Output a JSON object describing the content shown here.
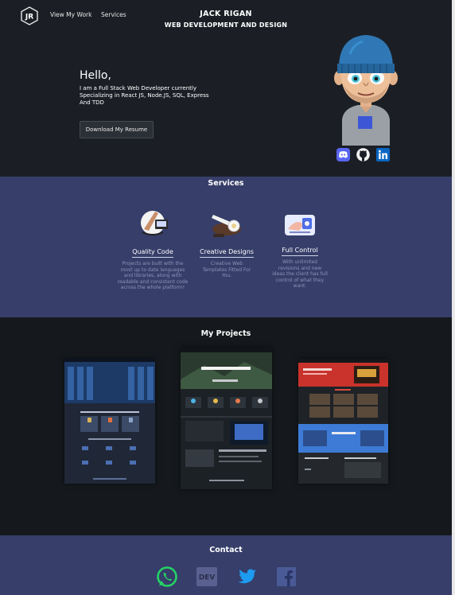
{
  "header": {
    "logo_text": "JR",
    "nav": {
      "work": "View My Work",
      "services": "Services"
    },
    "name": "JACK RIGAN",
    "subtitle": "WEB DEVELOPMENT AND DESIGN"
  },
  "hero": {
    "greeting": "Hello,",
    "intro": "I am a Full Stack Web Developer currently Specializing in React JS, Node.JS, SQL, Express And TDD",
    "resume_button": "Download My Resume",
    "social_icons": [
      "discord-icon",
      "github-icon",
      "linkedin-icon"
    ]
  },
  "services": {
    "title": "Services",
    "items": [
      {
        "title": "Quality Code",
        "desc": "Projects are built with the most up to date languages and libraries, along with readable and consistent code across the whole platform!"
      },
      {
        "title": "Creative Designs",
        "desc": "Creative Web Templates Fitted For You."
      },
      {
        "title": "Full Control",
        "desc": "With unlimited revisions and new ideas the client has full control of what they want."
      }
    ]
  },
  "projects": {
    "title": "My Projects"
  },
  "contact": {
    "title": "Contact",
    "icons": [
      "whatsapp-icon",
      "dev-icon",
      "twitter-icon",
      "facebook-icon"
    ],
    "dev_label": "DEV"
  },
  "colors": {
    "hero_bg": "#1b1f25",
    "section_bg": "#363e69",
    "page_bg": "#15191d",
    "discord": "#5865f2",
    "linkedin": "#0a66c2",
    "whatsapp": "#25d366",
    "twitter": "#1da1f2",
    "facebook": "#3b5998"
  }
}
